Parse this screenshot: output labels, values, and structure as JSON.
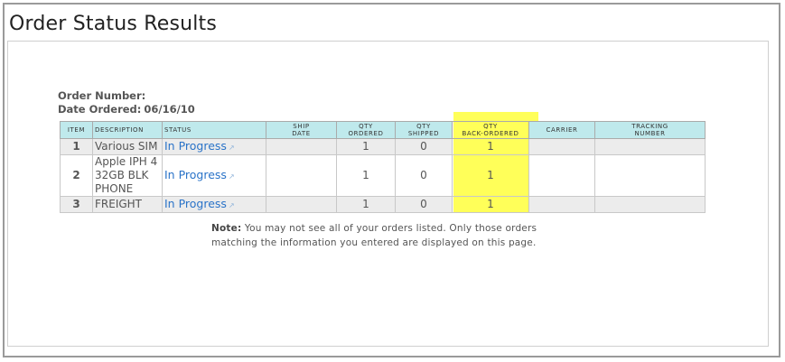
{
  "page": {
    "title": "Order Status Results"
  },
  "order": {
    "number_label": "Order Number:",
    "number_value": "",
    "date_label": "Date Ordered:",
    "date_value": "06/16/10"
  },
  "table": {
    "headers": {
      "item": "ITEM",
      "description": "DESCRIPTION",
      "status": "STATUS",
      "ship_date_1": "SHIP",
      "ship_date_2": "DATE",
      "qty_ordered_1": "QTY",
      "qty_ordered_2": "ORDERED",
      "qty_shipped_1": "QTY",
      "qty_shipped_2": "SHIPPED",
      "qty_backordered_1": "QTY",
      "qty_backordered_2": "BACK-ORDERED",
      "carrier": "CARRIER",
      "tracking_1": "TRACKING",
      "tracking_2": "NUMBER"
    },
    "rows": [
      {
        "item": "1",
        "description": "Various SIM",
        "status": "In Progress",
        "ship_date": "",
        "qty_ordered": "1",
        "qty_shipped": "0",
        "qty_backordered": "1",
        "carrier": "",
        "tracking": ""
      },
      {
        "item": "2",
        "description": "Apple IPH 4 32GB BLK PHONE",
        "status": "In Progress",
        "ship_date": "",
        "qty_ordered": "1",
        "qty_shipped": "0",
        "qty_backordered": "1",
        "carrier": "",
        "tracking": ""
      },
      {
        "item": "3",
        "description": "FREIGHT",
        "status": "In Progress",
        "ship_date": "",
        "qty_ordered": "1",
        "qty_shipped": "0",
        "qty_backordered": "1",
        "carrier": "",
        "tracking": ""
      }
    ]
  },
  "note": {
    "label": "Note:",
    "text": " You may not see all of your orders listed. Only those orders matching the information you entered are displayed on this page."
  },
  "icons": {
    "status_link_icon": "external-link-icon"
  },
  "colors": {
    "header_bg": "#bfe9ec",
    "link": "#2a73c8",
    "highlight": "#ffff3c",
    "row_alt": "#ececec"
  }
}
